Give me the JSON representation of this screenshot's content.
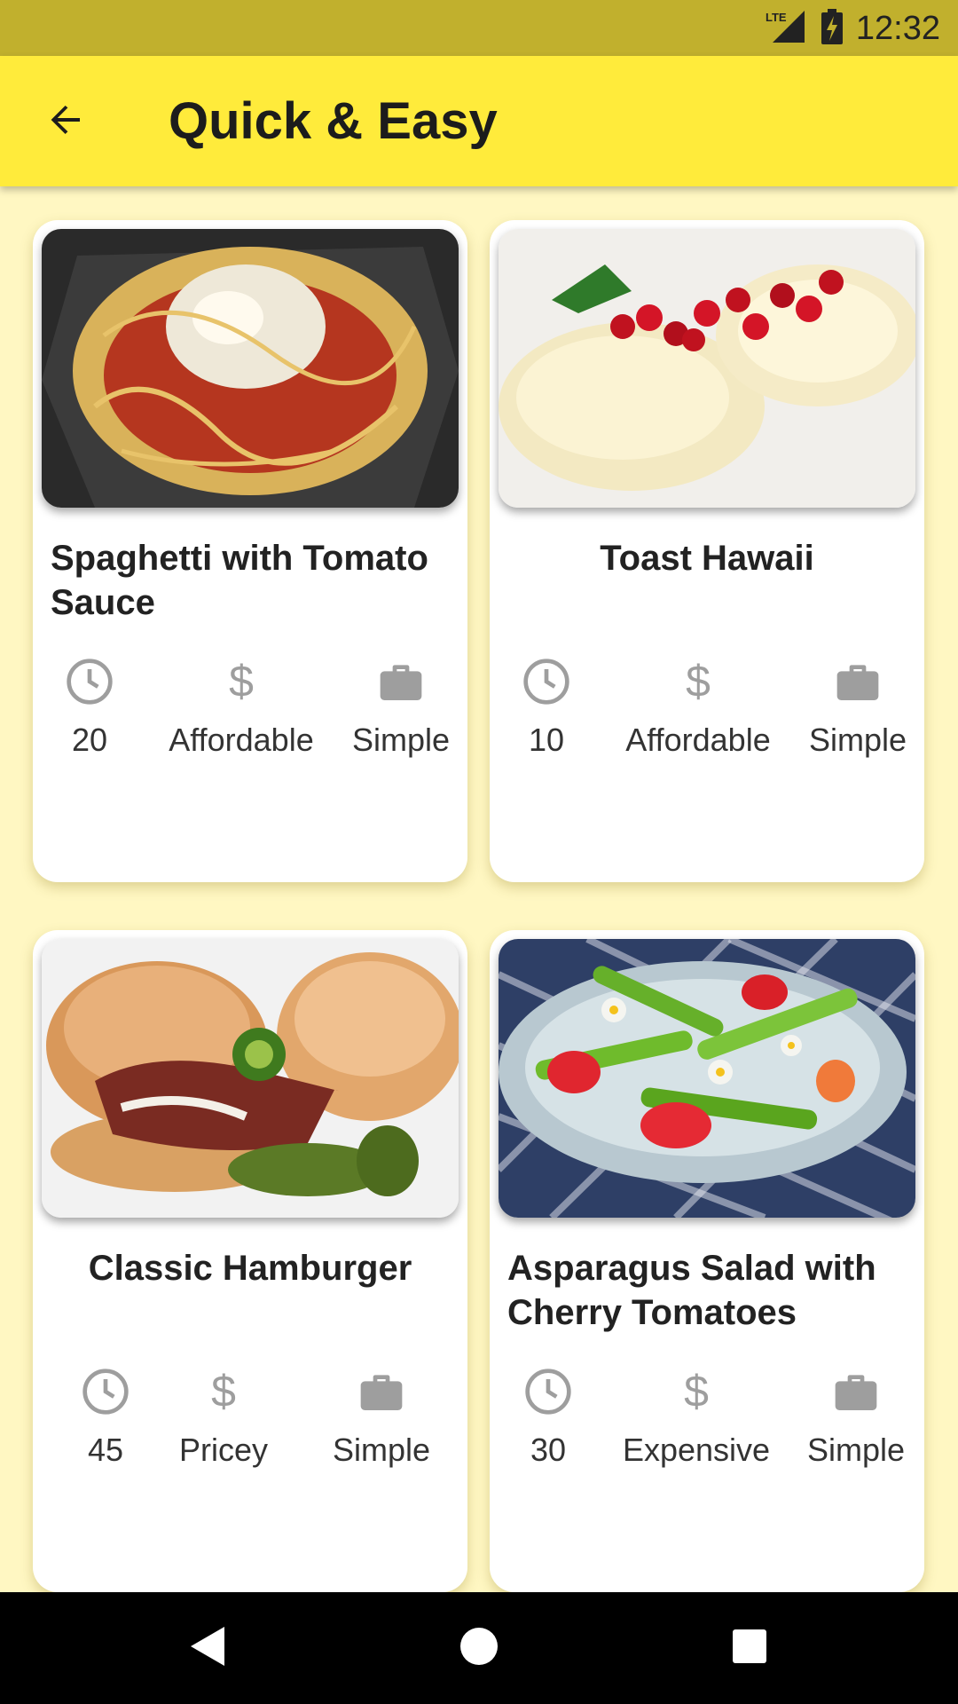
{
  "status_bar": {
    "network": "LTE",
    "time": "12:32",
    "icons": [
      "signal-icon",
      "battery-charging-icon"
    ]
  },
  "app_bar": {
    "title": "Quick & Easy",
    "back_icon": "arrow-back-icon"
  },
  "colors": {
    "app_bar": "#FFEB3B",
    "status_bar": "#C1B02D",
    "background": "#FFF7C2",
    "icon_grey": "#9E9E9E"
  },
  "meals": [
    {
      "title": "Spaghetti with Tomato Sauce",
      "duration": "20",
      "affordability": "Affordable",
      "complexity": "Simple",
      "image": "spaghetti-photo"
    },
    {
      "title": "Toast Hawaii",
      "duration": "10",
      "affordability": "Affordable",
      "complexity": "Simple",
      "image": "toast-hawaii-photo"
    },
    {
      "title": "Classic Hamburger",
      "duration": "45",
      "affordability": "Pricey",
      "complexity": "Simple",
      "image": "hamburger-photo"
    },
    {
      "title": "Asparagus Salad with Cherry Tomatoes",
      "duration": "30",
      "affordability": "Expensive",
      "complexity": "Simple",
      "image": "asparagus-salad-photo"
    }
  ],
  "meta_icons": {
    "duration": "clock-icon",
    "affordability": "dollar-icon",
    "complexity": "briefcase-icon"
  },
  "nav_bar": {
    "buttons": [
      "back-triangle-icon",
      "home-circle-icon",
      "recents-square-icon"
    ]
  }
}
